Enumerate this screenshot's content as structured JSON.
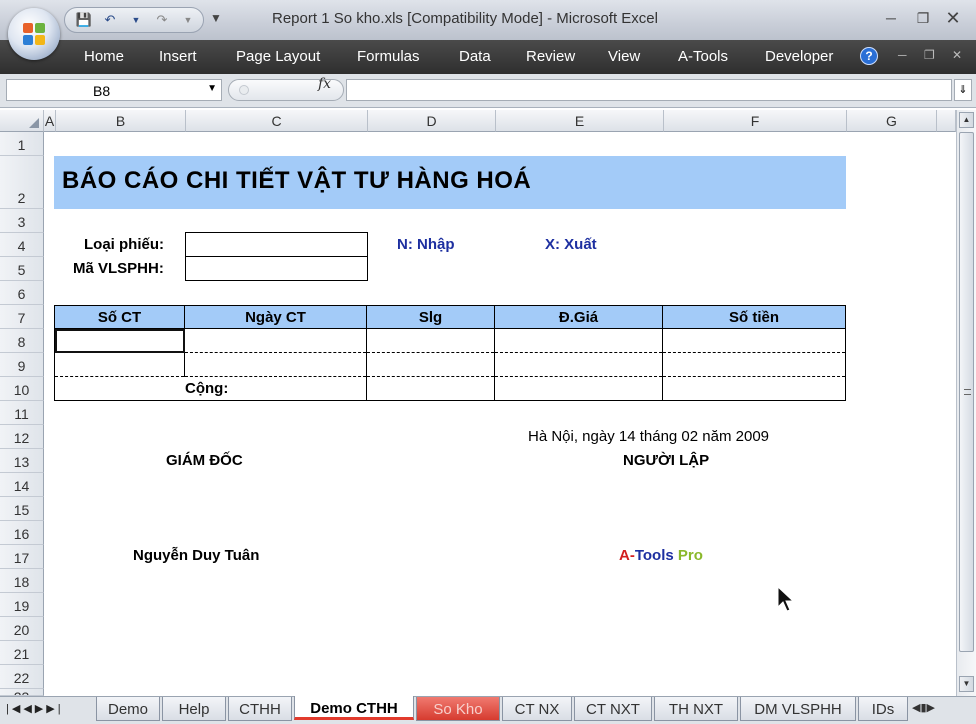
{
  "window": {
    "title": "Report 1 So kho.xls  [Compatibility Mode] - Microsoft Excel"
  },
  "ribbon": {
    "tabs": [
      "Home",
      "Insert",
      "Page Layout",
      "Formulas",
      "Data",
      "Review",
      "View",
      "A-Tools",
      "Developer"
    ]
  },
  "formula_bar": {
    "name_box": "B8",
    "fx_label": "fx",
    "formula": ""
  },
  "columns": [
    "A",
    "B",
    "C",
    "D",
    "E",
    "F",
    "G"
  ],
  "rows": [
    "1",
    "2",
    "3",
    "4",
    "5",
    "6",
    "7",
    "8",
    "9",
    "10",
    "11",
    "12",
    "13",
    "14",
    "15",
    "16",
    "17",
    "18",
    "19",
    "20",
    "21",
    "22",
    "23"
  ],
  "sheet": {
    "report_title": "BÁO CÁO CHI TIẾT VẬT TƯ HÀNG HOÁ",
    "label_voucher_type": "Loại phiếu:",
    "label_item_code": "Mã VLSPHH:",
    "legend_in": "N: Nhập",
    "legend_out": "X: Xuất",
    "table_headers": [
      "Số CT",
      "Ngày CT",
      "Slg",
      "Đ.Giá",
      "Số tiền"
    ],
    "total_label": "Cộng:",
    "place_date": "Hà Nội, ngày 14 tháng 02 năm 2009",
    "director_title": "GIÁM ĐỐC",
    "preparer_title": "NGƯỜI LẬP",
    "director_name": "Nguyễn Duy Tuân",
    "brand": {
      "a": "A",
      "dash": "-",
      "tools": "Tools",
      "pro": " Pro"
    }
  },
  "colors": {
    "header_fill": "#a3cbf8",
    "legend_blue": "#1d2fa0",
    "brand_red": "#d21f1f",
    "brand_blue": "#1d2fa0",
    "brand_green": "#8ab82a"
  },
  "sheet_tabs": [
    "Demo",
    "Help",
    "CTHH",
    "Demo CTHH",
    "So Kho",
    "CT NX",
    "CT NXT",
    "TH NXT",
    "DM VLSPHH",
    "IDs"
  ],
  "active_tab": "Demo CTHH"
}
